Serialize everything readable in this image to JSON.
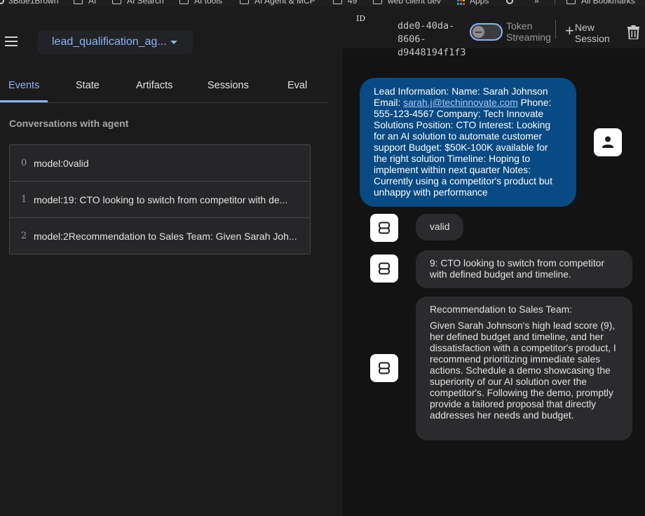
{
  "bookmarks": [
    {
      "label": "3Blue1Brown",
      "icon": "circle-icon"
    },
    {
      "label": "AI",
      "icon": "folder-icon"
    },
    {
      "label": "AI Search",
      "icon": "folder-icon"
    },
    {
      "label": "AI tools",
      "icon": "folder-icon"
    },
    {
      "label": "AI Agent & MCP",
      "icon": "folder-icon"
    },
    {
      "label": "49",
      "icon": "folder-icon"
    },
    {
      "label": "web client dev",
      "icon": "folder-icon"
    },
    {
      "label": "Apps",
      "icon": "apps-grid-icon"
    },
    {
      "label": "",
      "icon": "globe-icon"
    },
    {
      "label": "»",
      "icon": "chevron-more-icon"
    },
    {
      "label": "All Bookmarks",
      "icon": "folder-icon"
    }
  ],
  "agent_selector": {
    "value": "lead_qualification_ag..."
  },
  "tabs": [
    {
      "label": "Events",
      "active": true
    },
    {
      "label": "State",
      "active": false
    },
    {
      "label": "Artifacts",
      "active": false
    },
    {
      "label": "Sessions",
      "active": false
    },
    {
      "label": "Eval",
      "active": false
    }
  ],
  "conversations": {
    "title": "Conversations with agent",
    "events": [
      {
        "index": "0",
        "text": "model:0valid"
      },
      {
        "index": "1",
        "text": "model:19: CTO looking to switch from competitor with de..."
      },
      {
        "index": "2",
        "text": "model:2Recommendation to Sales Team: Given Sarah Joh..."
      }
    ]
  },
  "header": {
    "id_label": "ID",
    "session_id": "dde0-40da-8606-d9448194f1f3",
    "streaming_label": "Token Streaming",
    "streaming_on": false,
    "new_session_label": "New Session"
  },
  "messages": {
    "user": {
      "before_email": "Lead Information: Name: Sarah Johnson Email: ",
      "email": "sarah.j@techinnovate.com",
      "after_email": " Phone: 555-123-4567 Company: Tech Innovate Solutions Position: CTO Interest: Looking for an AI solution to automate customer support Budget: $50K-100K available for the right solution Timeline: Hoping to implement within next quarter Notes: Currently using a competitor's product but unhappy with performance"
    },
    "bot": [
      {
        "text": "valid"
      },
      {
        "text": "9: CTO looking to switch from competitor with defined budget and timeline."
      },
      {
        "heading": "Recommendation to Sales Team:",
        "text": "Given Sarah Johnson's high lead score (9), her defined budget and timeline, and her dissatisfaction with a competitor's product, I recommend prioritizing immediate sales actions. Schedule a demo showcasing the superiority of our AI solution over the competitor's. Following the demo, promptly provide a tailored proposal that directly addresses her needs and budget."
      }
    ]
  },
  "colors": {
    "accent": "#8ab4f8",
    "user_bubble": "#084a83",
    "bot_bubble": "#2b2b2d"
  }
}
